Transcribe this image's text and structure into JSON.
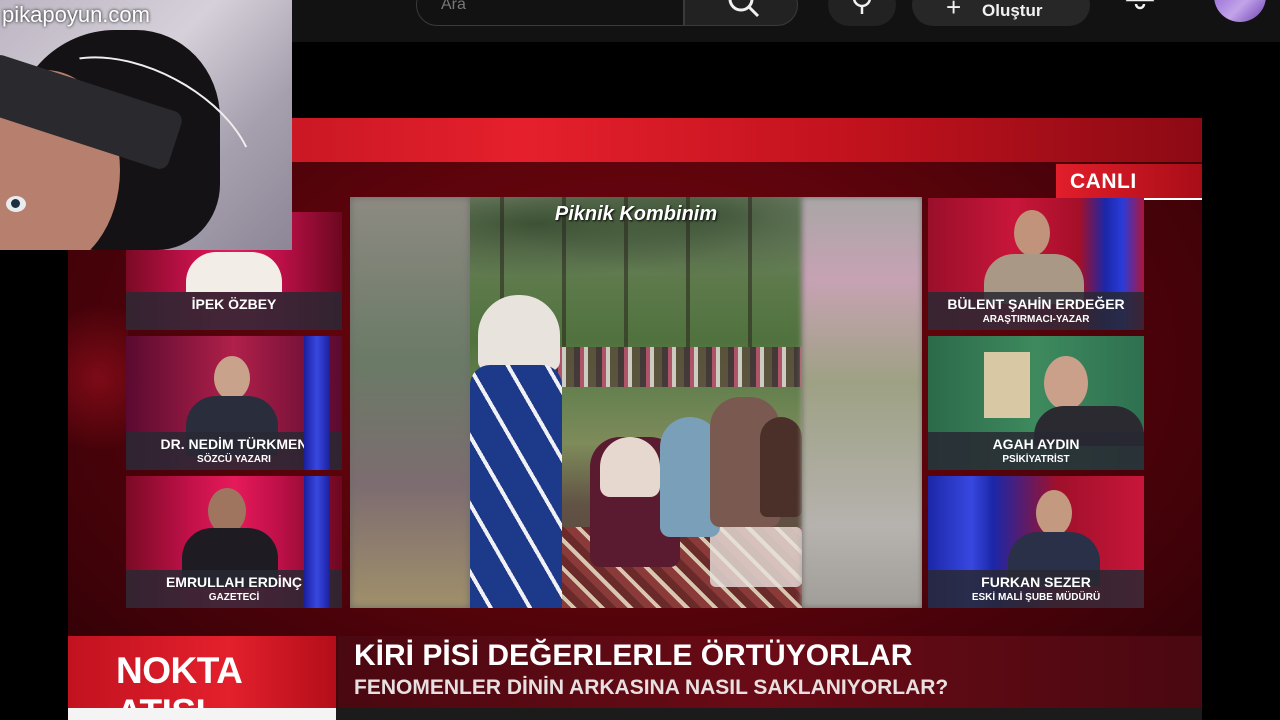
{
  "watermark": "pikapoyun.com",
  "topbar": {
    "search_placeholder": "Ara",
    "create_label": "Oluştur"
  },
  "broadcast": {
    "live_badge": "CANLI",
    "show_name": "NOKTA ATIŞI",
    "headline": "KİRİ PİSİ DEĞERLERLE ÖRTÜYORLAR",
    "subheadline": "FENOMENLER DİNİN ARKASINA NASIL SAKLANIYORLAR?",
    "clip_caption": "Piknik Kombinim",
    "panelists_left": [
      {
        "name": "İPEK ÖZBEY",
        "role": ""
      },
      {
        "name": "DR. NEDİM TÜRKMEN",
        "role": "SÖZCÜ YAZARI"
      },
      {
        "name": "EMRULLAH ERDİNÇ",
        "role": "GAZETECİ"
      }
    ],
    "panelists_right": [
      {
        "name": "BÜLENT ŞAHİN ERDEĞER",
        "role": "ARAŞTIRMACI-YAZAR"
      },
      {
        "name": "AGAH AYDIN",
        "role": "PSİKİYATRİST"
      },
      {
        "name": "FURKAN SEZER",
        "role": "ESKİ MALİ ŞUBE MÜDÜRÜ"
      }
    ]
  },
  "colors": {
    "accent_red": "#e3202c",
    "panel_blue": "#3848e0",
    "studio_pink": "#e61a5a"
  },
  "icons": [
    "search-icon",
    "mic-icon",
    "plus-icon",
    "bell-icon"
  ]
}
